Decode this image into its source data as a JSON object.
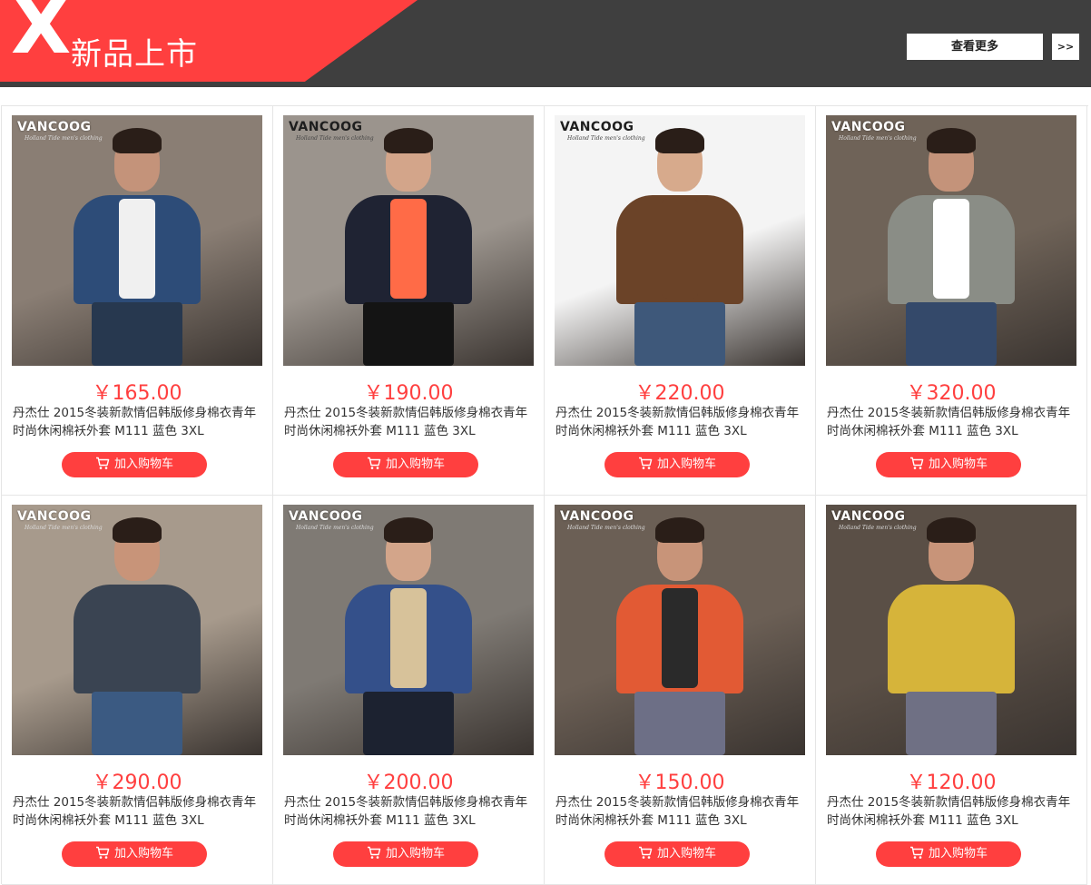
{
  "header": {
    "logo_letter": "X",
    "title": "新品上市",
    "more_label": "查看更多",
    "arrow_label": ">>"
  },
  "products": [
    {
      "brand": "VANCOOG",
      "brand_sub": "Holland Tide men's clothing",
      "price": "￥165.00",
      "desc": "丹杰仕 2015冬装新款情侣韩版修身棉衣青年时尚休闲棉袄外套 M111 蓝色 3XL",
      "cart_label": "加入购物车",
      "style": {
        "bg": "#8a7e74",
        "top": "#2d4c78",
        "inner": "#f0f0f0",
        "legs": "#27384f",
        "skin": "#c4937a",
        "brand_dark": false
      }
    },
    {
      "brand": "VANCOOG",
      "brand_sub": "Holland Tide men's clothing",
      "price": "￥190.00",
      "desc": "丹杰仕 2015冬装新款情侣韩版修身棉衣青年时尚休闲棉袄外套 M111 蓝色 3XL",
      "cart_label": "加入购物车",
      "style": {
        "bg": "#9b948d",
        "top": "#1f2333",
        "inner": "#ff6b47",
        "legs": "#141414",
        "skin": "#d3a58a",
        "brand_dark": true
      }
    },
    {
      "brand": "VANCOOG",
      "brand_sub": "Holland Tide men's clothing",
      "price": "￥220.00",
      "desc": "丹杰仕 2015冬装新款情侣韩版修身棉衣青年时尚休闲棉袄外套 M111 蓝色 3XL",
      "cart_label": "加入购物车",
      "style": {
        "bg": "#f4f4f4",
        "top": "#6b4328",
        "inner": "#6b4328",
        "legs": "#3e587a",
        "skin": "#d7aa8c",
        "brand_dark": true
      }
    },
    {
      "brand": "VANCOOG",
      "brand_sub": "Holland Tide men's clothing",
      "price": "￥320.00",
      "desc": "丹杰仕 2015冬装新款情侣韩版修身棉衣青年时尚休闲棉袄外套 M111 蓝色 3XL",
      "cart_label": "加入购物车",
      "style": {
        "bg": "#6f6358",
        "top": "#8a8d86",
        "inner": "#ffffff",
        "legs": "#34496a",
        "skin": "#c4937a",
        "brand_dark": false
      }
    },
    {
      "brand": "VANCOOG",
      "brand_sub": "Holland Tide men's clothing",
      "price": "￥290.00",
      "desc": "丹杰仕 2015冬装新款情侣韩版修身棉衣青年时尚休闲棉袄外套 M111 蓝色 3XL",
      "cart_label": "加入购物车",
      "style": {
        "bg": "#a79a8c",
        "top": "#3a4452",
        "inner": "#3a4452",
        "legs": "#3b5a82",
        "skin": "#c89479",
        "brand_dark": false
      }
    },
    {
      "brand": "VANCOOG",
      "brand_sub": "Holland Tide men's clothing",
      "price": "￥200.00",
      "desc": "丹杰仕 2015冬装新款情侣韩版修身棉衣青年时尚休闲棉袄外套 M111 蓝色 3XL",
      "cart_label": "加入购物车",
      "style": {
        "bg": "#7f7a74",
        "top": "#34508a",
        "inner": "#d7c29a",
        "legs": "#1c2230",
        "skin": "#d3a58a",
        "brand_dark": false
      }
    },
    {
      "brand": "VANCOOG",
      "brand_sub": "Holland Tide men's clothing",
      "price": "￥150.00",
      "desc": "丹杰仕 2015冬装新款情侣韩版修身棉衣青年时尚休闲棉袄外套 M111 蓝色 3XL",
      "cart_label": "加入购物车",
      "style": {
        "bg": "#6b5f55",
        "top": "#e25a34",
        "inner": "#2a2a2a",
        "legs": "#6d6f86",
        "skin": "#c89479",
        "brand_dark": false
      }
    },
    {
      "brand": "VANCOOG",
      "brand_sub": "Holland Tide men's clothing",
      "price": "￥120.00",
      "desc": "丹杰仕 2015冬装新款情侣韩版修身棉衣青年时尚休闲棉袄外套 M111 蓝色 3XL",
      "cart_label": "加入购物车",
      "style": {
        "bg": "#5a4f46",
        "top": "#d6b43a",
        "inner": "#d6b43a",
        "legs": "#6f7084",
        "skin": "#c89479",
        "brand_dark": false
      }
    }
  ]
}
